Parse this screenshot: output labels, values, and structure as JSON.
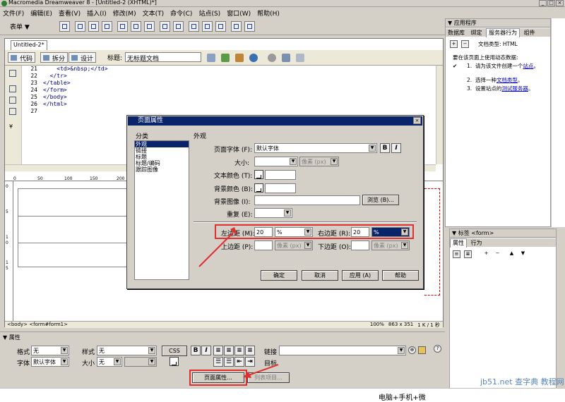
{
  "window": {
    "title": "Macromedia Dreamweaver 8 - [Untitled-2 (XHTML)*]"
  },
  "menu": [
    "文件(F)",
    "编辑(E)",
    "查看(V)",
    "插入(I)",
    "修改(M)",
    "文本(T)",
    "命令(C)",
    "站点(S)",
    "窗口(W)",
    "帮助(H)"
  ],
  "insertbar": {
    "tab": "表单 ▼"
  },
  "document": {
    "tab": "Untitled-2*",
    "views": {
      "code": "代码",
      "split": "拆分",
      "design": "设计"
    },
    "title_label": "标题:",
    "title_value": "无标题文档",
    "code_lines": [
      {
        "num": "21",
        "code": "    <td>&nbsp;</td>"
      },
      {
        "num": "22",
        "code": "  </tr>"
      },
      {
        "num": "23",
        "code": "</table>"
      },
      {
        "num": "24",
        "code": "</form>"
      },
      {
        "num": "25",
        "code": "</body>"
      },
      {
        "num": "26",
        "code": "</html>"
      },
      {
        "num": "27",
        "code": ""
      }
    ],
    "ruler": [
      "0",
      "50",
      "100",
      "150",
      "200"
    ],
    "vruler": [
      "0",
      "5",
      "1",
      "0",
      "1",
      "5"
    ],
    "status_tag": "<body> <form#form1>",
    "zoom": "100%",
    "size": "863 x 351",
    "load": "1 K / 1 秒"
  },
  "dialog": {
    "title": "页面属性",
    "category_label": "分类",
    "categories": [
      "外观",
      "链接",
      "标题",
      "标题/编码",
      "跟踪图像"
    ],
    "section_label": "外观",
    "font_label": "页面字体 (F):",
    "font_value": "默认字体",
    "bold": "B",
    "italic": "I",
    "size_label": "大小:",
    "unit_px": "像素 (px)",
    "text_color_label": "文本颜色 (T):",
    "bg_color_label": "背景颜色 (B):",
    "bg_image_label": "背景图像 (I):",
    "browse": "浏览 (B)...",
    "repeat_label": "重复 (E):",
    "left_margin_label": "左边距 (M):",
    "left_margin_value": "20",
    "left_margin_unit": "%",
    "right_margin_label": "右边距 (R):",
    "right_margin_value": "20",
    "right_margin_unit": "%",
    "top_margin_label": "上边距 (P):",
    "bottom_margin_label": "下边距 (O):",
    "ok": "确定",
    "cancel": "取消",
    "apply": "应用 (A)",
    "help": "帮助"
  },
  "app_panel": {
    "header": "▼ 应用程序",
    "tabs": [
      "数据库",
      "绑定",
      "服务器行为",
      "组件"
    ],
    "doc_type": "文档类型: HTML",
    "intro": "要在该页面上使用动态数据:",
    "steps": [
      {
        "n": "1.",
        "before": "请为该文件创建一个",
        "link": "站点",
        "after": "。"
      },
      {
        "n": "2.",
        "before": "选择一种",
        "link": "文档类型",
        "after": "。"
      },
      {
        "n": "3.",
        "before": "设置站点的",
        "link": "测试服务器",
        "after": "。"
      }
    ]
  },
  "tag_panel": {
    "header": "▼ 标签 <form>",
    "tabs": [
      "属性",
      "行为"
    ]
  },
  "properties": {
    "header": "▼ 属性",
    "format_label": "格式",
    "format_value": "无",
    "style_label": "样式",
    "style_value": "无",
    "css": "CSS",
    "font_label": "字体",
    "font_value": "默认字体",
    "size_label": "大小",
    "size_value": "无",
    "link_label": "链接",
    "target_label": "目标",
    "page_props_button": "页面属性...",
    "list_item_button": "列表项目..."
  },
  "bottom_text": "电脑+手机+微",
  "watermark": "jb51.net 查字典 教程网",
  "colors": {
    "highlight": "#e03030",
    "title_bar": "#0a246a",
    "chrome": "#d4d0c8",
    "link": "#0000cc"
  }
}
